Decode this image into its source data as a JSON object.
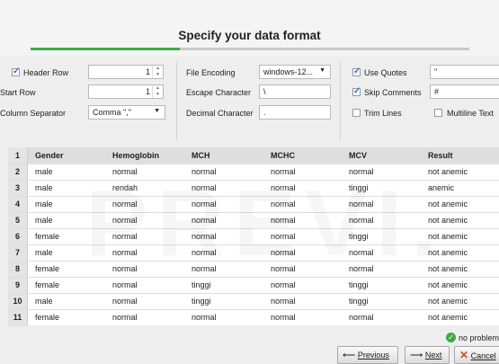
{
  "title": "Specify your data format",
  "progress": 0.34,
  "options": {
    "header_row": {
      "label": "Header Row",
      "checked": true,
      "value": "1"
    },
    "start_row": {
      "label": "Start Row",
      "value": "1"
    },
    "column_separator": {
      "label": "Column Separator",
      "value": "Comma \",\""
    },
    "file_encoding": {
      "label": "File Encoding",
      "value": "windows-12..."
    },
    "escape_character": {
      "label": "Escape Character",
      "value": "\\"
    },
    "decimal_character": {
      "label": "Decimal Character",
      "value": "."
    },
    "use_quotes": {
      "label": "Use Quotes",
      "checked": true,
      "value": "\""
    },
    "skip_comments": {
      "label": "Skip Comments",
      "checked": true,
      "value": "#"
    },
    "trim_lines": {
      "label": "Trim Lines",
      "checked": false
    },
    "multiline_text": {
      "label": "Multiline Text",
      "checked": false
    }
  },
  "table": {
    "header_number": "1",
    "columns": [
      "Gender",
      "Hemoglobin",
      "MCH",
      "MCHC",
      "MCV",
      "Result"
    ],
    "rows": [
      {
        "n": "2",
        "cells": [
          "male",
          "normal",
          "normal",
          "normal",
          "normal",
          "not anemic"
        ]
      },
      {
        "n": "3",
        "cells": [
          "male",
          "rendah",
          "normal",
          "normal",
          "tinggi",
          "anemic"
        ]
      },
      {
        "n": "4",
        "cells": [
          "male",
          "normal",
          "normal",
          "normal",
          "normal",
          "not anemic"
        ]
      },
      {
        "n": "5",
        "cells": [
          "male",
          "normal",
          "normal",
          "normal",
          "normal",
          "not anemic"
        ]
      },
      {
        "n": "6",
        "cells": [
          "female",
          "normal",
          "normal",
          "normal",
          "tinggi",
          "not anemic"
        ]
      },
      {
        "n": "7",
        "cells": [
          "male",
          "normal",
          "normal",
          "normal",
          "normal",
          "not anemic"
        ]
      },
      {
        "n": "8",
        "cells": [
          "female",
          "normal",
          "normal",
          "normal",
          "normal",
          "not anemic"
        ]
      },
      {
        "n": "9",
        "cells": [
          "female",
          "normal",
          "tinggi",
          "normal",
          "tinggi",
          "not anemic"
        ]
      },
      {
        "n": "10",
        "cells": [
          "male",
          "normal",
          "tinggi",
          "normal",
          "tinggi",
          "not anemic"
        ]
      },
      {
        "n": "11",
        "cells": [
          "female",
          "normal",
          "normal",
          "normal",
          "normal",
          "not anemic"
        ]
      }
    ]
  },
  "watermark": "PREVI.",
  "status": {
    "text": "no problem",
    "icon": "check-circle-icon",
    "color": "#3fa94a"
  },
  "buttons": {
    "previous": {
      "label": "Previous",
      "icon": "arrow-left-icon"
    },
    "next": {
      "label": "Next",
      "icon": "arrow-right-icon"
    },
    "cancel": {
      "label": "Cancel",
      "icon": "cross-icon"
    }
  },
  "colors": {
    "accent": "#3fa94a",
    "check": "#2c6dd2",
    "cancel": "#d64b1e"
  }
}
